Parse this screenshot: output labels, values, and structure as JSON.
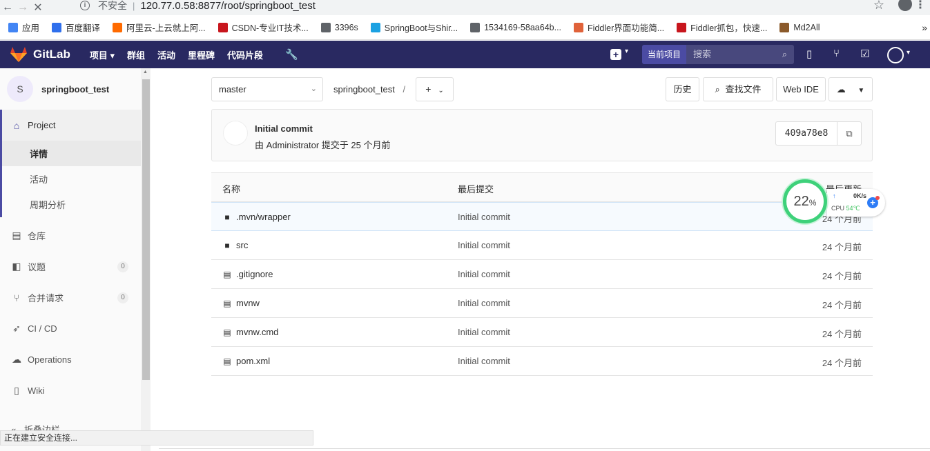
{
  "browser": {
    "insecure_label": "不安全",
    "url": "120.77.0.58:8877/root/springboot_test",
    "bookmarks": [
      {
        "label": "应用",
        "color": "#4285f4"
      },
      {
        "label": "百度翻译",
        "color": "#2f6fec"
      },
      {
        "label": "阿里云-上云就上阿...",
        "color": "#ff6a00"
      },
      {
        "label": "CSDN-专业IT技术...",
        "color": "#c8161d"
      },
      {
        "label": "3396s",
        "color": "#5f6368"
      },
      {
        "label": "SpringBoot与Shir...",
        "color": "#1ba1e2"
      },
      {
        "label": "1534169-58aa64b...",
        "color": "#5f6368"
      },
      {
        "label": "Fiddler界面功能简...",
        "color": "#e0623a"
      },
      {
        "label": "Fiddler抓包，快速...",
        "color": "#c8161d"
      },
      {
        "label": "Md2All",
        "color": "#8b5a2b"
      }
    ],
    "status_text": "正在建立安全连接..."
  },
  "topnav": {
    "brand": "GitLab",
    "items": [
      "项目",
      "群组",
      "活动",
      "里程碑",
      "代码片段"
    ],
    "scope_label": "当前项目",
    "search_placeholder": "搜索"
  },
  "sidebar": {
    "project_initial": "S",
    "project_name": "springboot_test",
    "project_label": "Project",
    "sub_items": [
      "详情",
      "活动",
      "周期分析"
    ],
    "items": [
      {
        "label": "仓库",
        "icon": "book-icon"
      },
      {
        "label": "议题",
        "icon": "issues-icon",
        "count": "0"
      },
      {
        "label": "合并请求",
        "icon": "merge-request-icon",
        "count": "0"
      },
      {
        "label": "CI / CD",
        "icon": "rocket-icon"
      },
      {
        "label": "Operations",
        "icon": "cloud-gear-icon"
      },
      {
        "label": "Wiki",
        "icon": "book-open-icon"
      }
    ],
    "collapse_label": "折叠边栏"
  },
  "repo": {
    "branch": "master",
    "breadcrumb": "springboot_test",
    "history_label": "历史",
    "find_file_label": "查找文件",
    "web_ide_label": "Web IDE"
  },
  "last_commit": {
    "title": "Initial commit",
    "meta": "由 Administrator 提交于 25 个月前",
    "sha": "409a78e8"
  },
  "files_table": {
    "headers": [
      "名称",
      "最后提交",
      "最后更新"
    ],
    "rows": [
      {
        "name": ".mvn/wrapper",
        "type": "folder",
        "commit": "Initial commit",
        "updated": "24 个月前"
      },
      {
        "name": "src",
        "type": "folder",
        "commit": "Initial commit",
        "updated": "24 个月前"
      },
      {
        "name": ".gitignore",
        "type": "file",
        "commit": "Initial commit",
        "updated": "24 个月前"
      },
      {
        "name": "mvnw",
        "type": "file",
        "commit": "Initial commit",
        "updated": "24 个月前"
      },
      {
        "name": "mvnw.cmd",
        "type": "file",
        "commit": "Initial commit",
        "updated": "24 个月前"
      },
      {
        "name": "pom.xml",
        "type": "file",
        "commit": "Initial commit",
        "updated": "24 个月前"
      }
    ]
  },
  "monitor": {
    "percent": "22",
    "percent_unit": "%",
    "net_speed": "0K/s",
    "cpu_label": "CPU",
    "cpu_temp": "54℃"
  }
}
